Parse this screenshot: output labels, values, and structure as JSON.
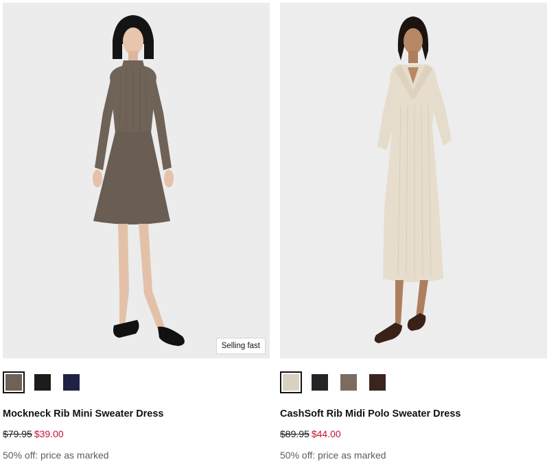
{
  "products": [
    {
      "name": "Mockneck Rib Mini Sweater Dress",
      "original_price": "$79.95",
      "sale_price": "$39.00",
      "promo": "50% off: price as marked",
      "badge": "Selling fast",
      "swatches": [
        {
          "color": "#6f6156",
          "selected": true
        },
        {
          "color": "#1c1c1c",
          "selected": false
        },
        {
          "color": "#1f2244",
          "selected": false
        }
      ]
    },
    {
      "name": "CashSoft Rib Midi Polo Sweater Dress",
      "original_price": "$89.95",
      "sale_price": "$44.00",
      "promo": "50% off: price as marked",
      "swatches": [
        {
          "color": "#d8d1c2",
          "selected": true
        },
        {
          "color": "#222427",
          "selected": false
        },
        {
          "color": "#7a6c60",
          "selected": false
        },
        {
          "color": "#3a2420",
          "selected": false
        }
      ]
    }
  ],
  "colors": {
    "sale": "#c8102e",
    "promo": "#5c5c5c",
    "image_bg": "#eeeeee"
  }
}
